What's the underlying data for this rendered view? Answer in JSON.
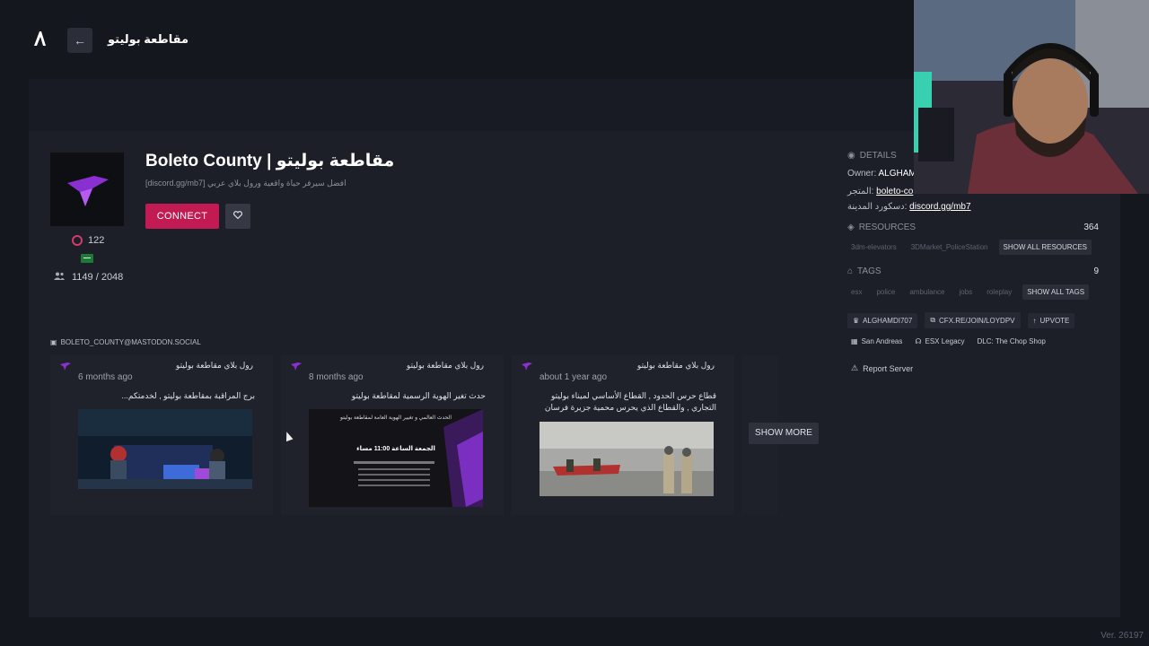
{
  "topbar": {
    "title": "مقاطعة بوليتو",
    "back_icon": "←"
  },
  "server": {
    "name": "Boleto County | مقاطعة بوليتو",
    "description": "[discord.gg/mb7] افضل سيرفر حياة واقعية ورول بلاي عربي",
    "connect_label": "CONNECT",
    "upvotes": "122",
    "players": "1149 / 2048"
  },
  "details": {
    "header": "DETAILS",
    "owner_label": "Owner:",
    "owner_value": "ALGHAM",
    "store_label": "المتجر:",
    "store_value": "boleto-co",
    "discord_label": "دسكورد المدينة:",
    "discord_value": "discord.gg/mb7"
  },
  "resources": {
    "header": "RESOURCES",
    "count": "364",
    "items": [
      "3dm-elevators",
      "3DMarket_PoliceStation"
    ],
    "show_all": "SHOW ALL RESOURCES"
  },
  "tags": {
    "header": "TAGS",
    "count": "9",
    "items": [
      "esx",
      "police",
      "ambulance",
      "jobs",
      "roleplay"
    ],
    "show_all": "SHOW ALL TAGS"
  },
  "links": {
    "owner_chip": "ALGHAMDI707",
    "join_chip": "CFX.RE/JOIN/LOYDPV",
    "upvote": "UPVOTE",
    "map": "San Andreas",
    "framework": "ESX Legacy",
    "dlc": "DLC: The Chop Shop"
  },
  "report": "Report Server",
  "mastodon": "BOLETO_COUNTY@MASTODON.SOCIAL",
  "posts": [
    {
      "author": "رول بلاي مقاطعة بوليتو",
      "time": "6 months ago",
      "text": "برج المراقبة بمقاطعة بوليتو , لخدمتكم..."
    },
    {
      "author": "رول بلاي مقاطعة بوليتو",
      "time": "8 months ago",
      "text": "حدث تغير الهوية الرسمية لمقاطعة بوليتو",
      "img_title": "الحدث العالمي و تغيير الهوية العامة لمقاطعة بوليتو",
      "img_sub": "الجمعة الساعة 11:00 مساء"
    },
    {
      "author": "رول بلاي مقاطعة بوليتو",
      "time": "about 1 year ago",
      "text": "قطاع حرس الحدود , القطاع الأساسي لميناء بوليتو التجاري , والقطاع الذي يحرس محمية جزيرة فرسان"
    }
  ],
  "show_more": "SHOW MORE",
  "version": "Ver. 26197",
  "colors": {
    "accent": "#c21a52",
    "background": "#15171f",
    "panel": "#1c1f28"
  }
}
